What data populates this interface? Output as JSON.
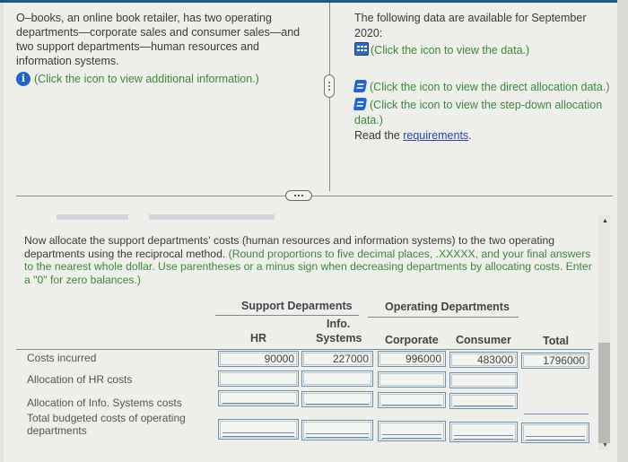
{
  "intro": {
    "text": "O–books, an online book retailer, has two operating departments—corporate sales and consumer sales—and two support departments—human resources and information systems.",
    "info_link": "(Click the icon to view additional information.)"
  },
  "data_panel": {
    "heading": "The following data are available for September 2020:",
    "data_link": "(Click the icon to view the data.)",
    "direct_link": "(Click the icon to view the direct allocation data.)",
    "stepdown_link": "(Click the icon to view the step-down allocation data.)",
    "read_prefix": "Read the ",
    "requirements_link": "requirements",
    "read_suffix": "."
  },
  "instructions": {
    "main": "Now allocate the support departments' costs (human resources and information systems) to the two operating departments using the reciprocal method.",
    "note": " (Round proportions to five decimal places, .XXXXX, and your final answers to the nearest whole dollar. Use parentheses or a minus sign when decreasing departments by allocating costs. Enter a \"0\" for zero balances.)"
  },
  "table": {
    "group_support": "Support Deparments",
    "group_operating": "Operating Departments",
    "columns": {
      "hr": "HR",
      "info_line1": "Info.",
      "info_line2": "Systems",
      "corporate": "Corporate",
      "consumer": "Consumer",
      "total": "Total"
    },
    "rows": [
      {
        "label": "Costs incurred",
        "hr": "90000",
        "info": "227000",
        "corporate": "996000",
        "consumer": "483000",
        "total": "1796000"
      },
      {
        "label": "Allocation of HR costs",
        "hr": "",
        "info": "",
        "corporate": "",
        "consumer": ""
      },
      {
        "label": "Allocation of Info. Systems costs",
        "hr": "",
        "info": "",
        "corporate": "",
        "consumer": ""
      },
      {
        "label": "Total budgeted costs of operating departments",
        "hr": "",
        "info": "",
        "corporate": "",
        "consumer": "",
        "total": ""
      }
    ]
  }
}
